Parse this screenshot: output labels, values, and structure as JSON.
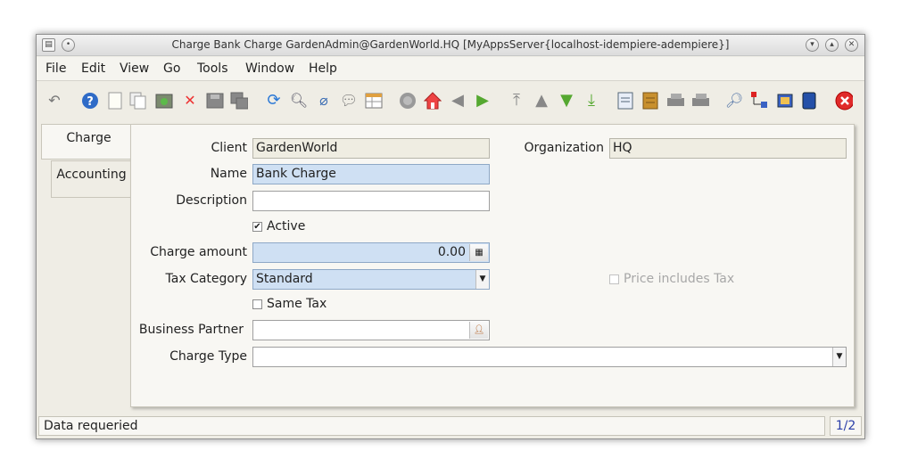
{
  "window": {
    "title": "Charge  Bank Charge  GardenAdmin@GardenWorld.HQ [MyAppsServer{localhost-idempiere-adempiere}]"
  },
  "menu": [
    {
      "label": "File"
    },
    {
      "label": "Edit"
    },
    {
      "label": "View"
    },
    {
      "label": "Go"
    },
    {
      "label": "Tools"
    },
    {
      "label": "Window"
    },
    {
      "label": "Help"
    }
  ],
  "toolbar_icons": [
    "undo-icon",
    "help-icon",
    "new-record-icon",
    "copy-record-icon",
    "save-archive-icon",
    "delete-icon",
    "save-icon",
    "save-multiple-icon",
    "refresh-icon",
    "find-icon",
    "attachment-icon",
    "chat-icon",
    "grid-toggle-icon",
    "history-icon",
    "home-icon",
    "back-icon",
    "forward-icon",
    "first-record-icon",
    "previous-record-icon",
    "next-record-icon",
    "last-record-icon",
    "report-icon",
    "archive-icon",
    "print-preview-icon",
    "print-icon",
    "zoom-across-icon",
    "workflow-icon",
    "product-info-icon",
    "end-icon",
    "close-window-icon"
  ],
  "tabs": [
    {
      "label": "Charge"
    },
    {
      "label": "Accounting"
    }
  ],
  "form": {
    "client": {
      "label": "Client",
      "value": "GardenWorld"
    },
    "organization": {
      "label": "Organization",
      "value": "HQ"
    },
    "name": {
      "label": "Name",
      "value": "Bank Charge"
    },
    "description": {
      "label": "Description",
      "value": ""
    },
    "active": {
      "label": "Active",
      "checked": true
    },
    "charge_amount": {
      "label": "Charge amount",
      "value": "0.00"
    },
    "tax_category": {
      "label": "Tax Category",
      "value": "Standard"
    },
    "price_includes_tax": {
      "label": "Price includes Tax",
      "checked": false
    },
    "same_tax": {
      "label": "Same Tax",
      "checked": false
    },
    "business_partner": {
      "label": "Business Partner",
      "value": ""
    },
    "charge_type": {
      "label": "Charge Type",
      "value": ""
    }
  },
  "status": {
    "message": "Data requeried",
    "record_count": "1/2"
  }
}
